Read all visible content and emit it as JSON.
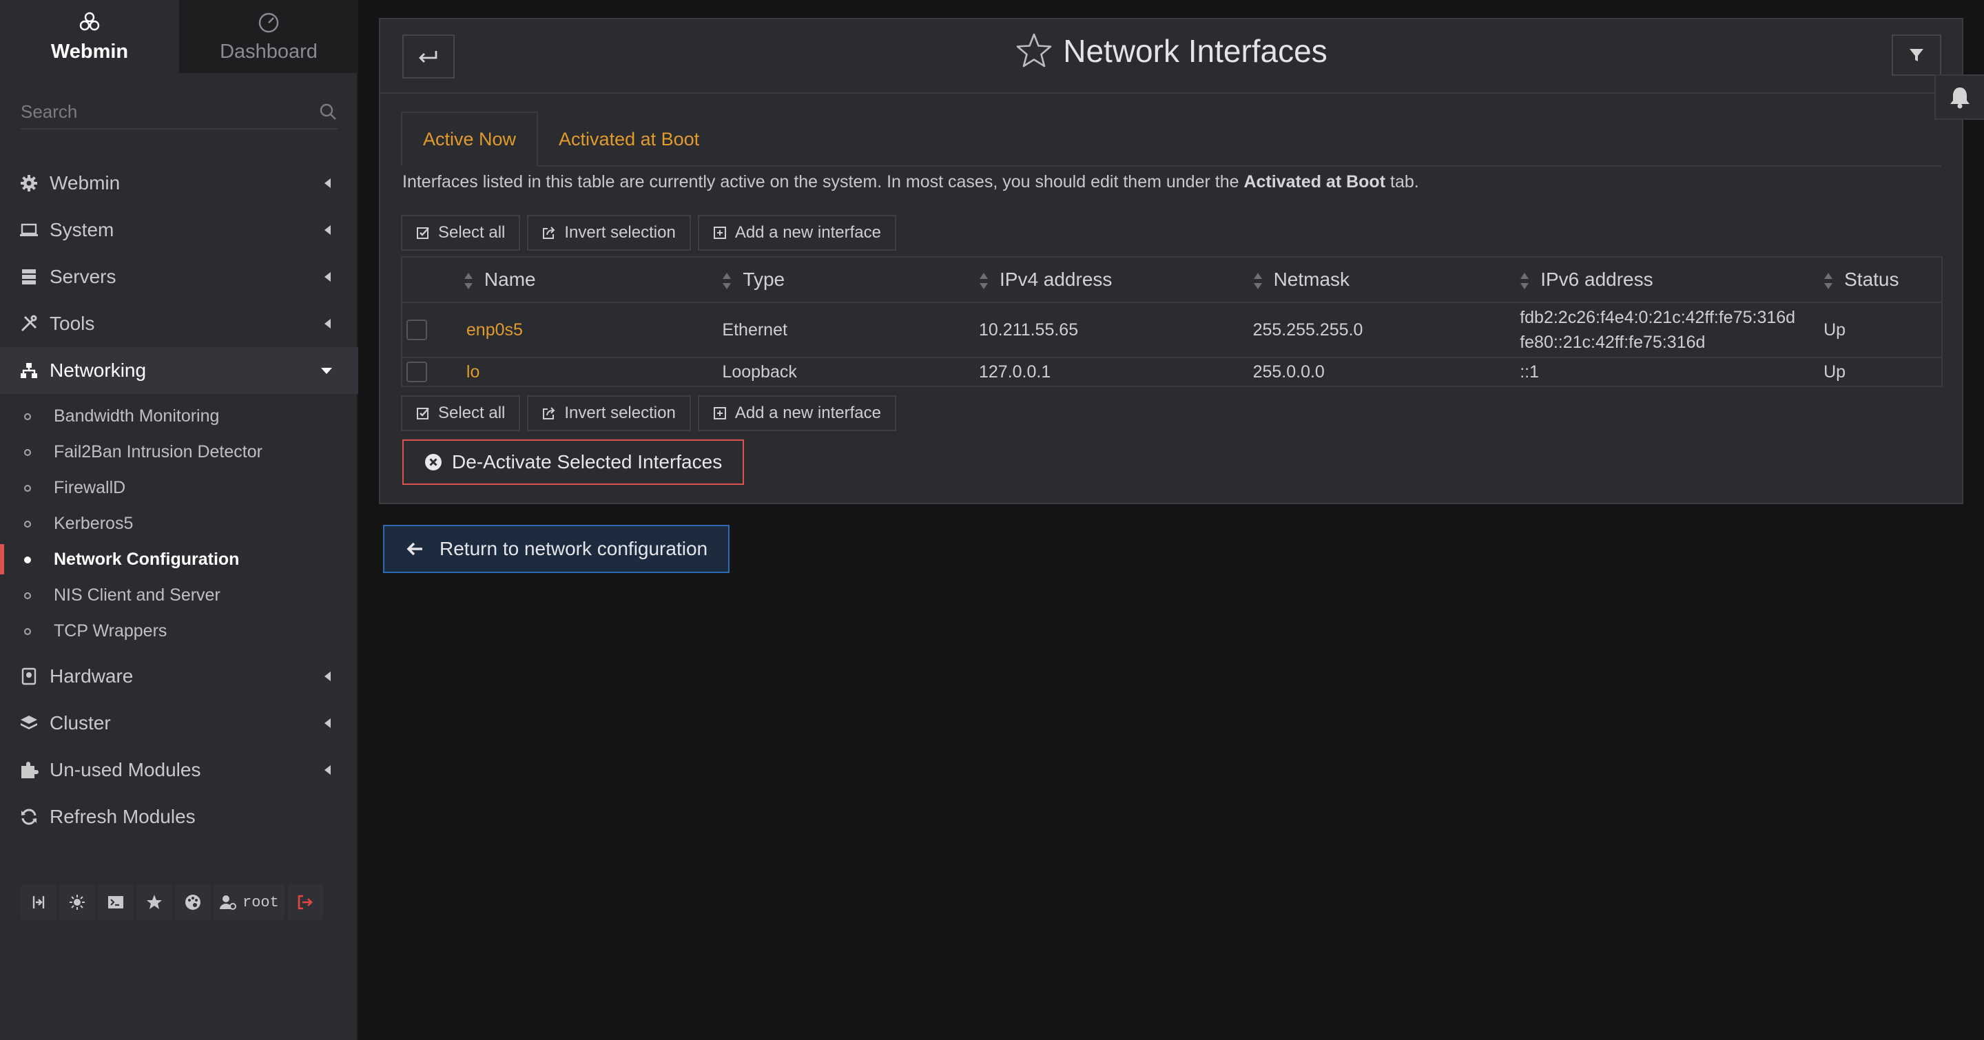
{
  "sidebar": {
    "tabs": [
      {
        "label": "Webmin",
        "icon": "webmin-logo-icon"
      },
      {
        "label": "Dashboard",
        "icon": "dashboard-gauge-icon"
      }
    ],
    "search_placeholder": "Search",
    "menu": [
      {
        "label": "Webmin",
        "icon": "gear-icon"
      },
      {
        "label": "System",
        "icon": "laptop-icon"
      },
      {
        "label": "Servers",
        "icon": "server-icon"
      },
      {
        "label": "Tools",
        "icon": "tools-icon"
      },
      {
        "label": "Networking",
        "icon": "network-icon"
      }
    ],
    "networking_items": [
      "Bandwidth Monitoring",
      "Fail2Ban Intrusion Detector",
      "FirewallD",
      "Kerberos5",
      "Network Configuration",
      "NIS Client and Server",
      "TCP Wrappers"
    ],
    "active_item": "Network Configuration",
    "menu_after": [
      {
        "label": "Hardware",
        "icon": "hardware-icon"
      },
      {
        "label": "Cluster",
        "icon": "layers-icon"
      },
      {
        "label": "Un-used Modules",
        "icon": "puzzle-icon"
      },
      {
        "label": "Refresh Modules",
        "icon": "refresh-icon"
      }
    ],
    "footer": {
      "user": "root"
    }
  },
  "page": {
    "title": "Network Interfaces",
    "tabs": [
      "Active Now",
      "Activated at Boot"
    ],
    "active_tab": "Active Now",
    "description_pre": "Interfaces listed in this table are currently active on the system. In most cases, you should edit them under the ",
    "description_bold": "Activated at Boot",
    "description_post": " tab.",
    "buttons": {
      "select_all": "Select all",
      "invert_selection": "Invert selection",
      "add_interface": "Add a new interface"
    },
    "table": {
      "columns": [
        "Name",
        "Type",
        "IPv4 address",
        "Netmask",
        "IPv6 address",
        "Status"
      ],
      "rows": [
        {
          "name": "enp0s5",
          "type": "Ethernet",
          "ipv4": "10.211.55.65",
          "netmask": "255.255.255.0",
          "ipv6_1": "fdb2:2c26:f4e4:0:21c:42ff:fe75:316d",
          "ipv6_2": "fe80::21c:42ff:fe75:316d",
          "status": "Up"
        },
        {
          "name": "lo",
          "type": "Loopback",
          "ipv4": "127.0.0.1",
          "netmask": "255.0.0.0",
          "ipv6_1": "::1",
          "ipv6_2": "",
          "status": "Up"
        }
      ]
    },
    "deactivate_label": "De-Activate Selected Interfaces",
    "return_label": "Return to network configuration"
  },
  "colors": {
    "accent": "#e29a2b",
    "danger": "#d9534f",
    "primary": "#2d6cb3",
    "sidebar_bg": "#2b2c30",
    "page_bg": "#141414"
  }
}
